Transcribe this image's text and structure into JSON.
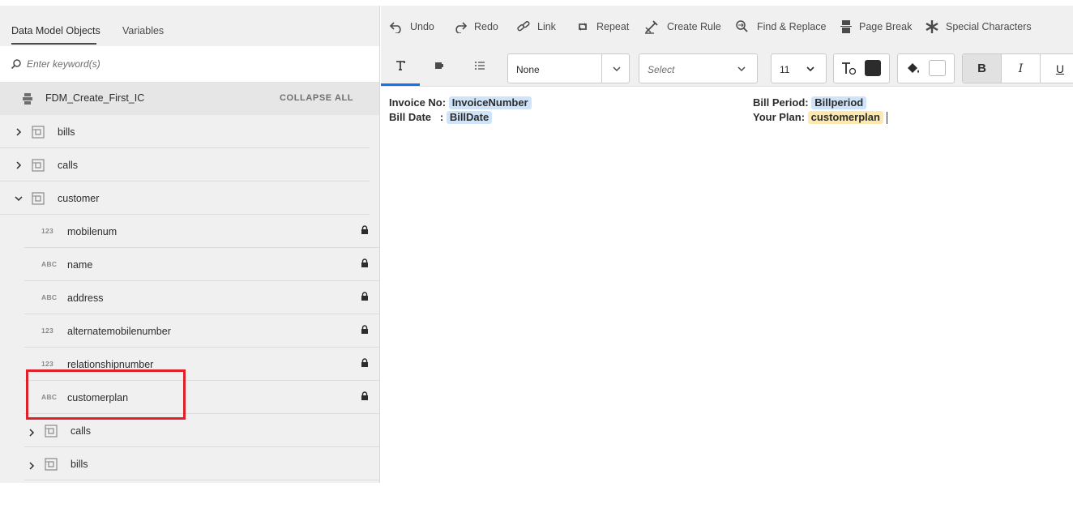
{
  "left_panel": {
    "tabs": [
      {
        "label": "Data Model Objects",
        "active": true
      },
      {
        "label": "Variables",
        "active": false
      }
    ],
    "search": {
      "placeholder": "Enter keyword(s)",
      "value": ""
    },
    "data_model": {
      "title": "FDM_Create_First_IC",
      "collapse_label": "COLLAPSE ALL"
    },
    "tree": [
      {
        "label": "bills",
        "kind": "object",
        "expanded": false,
        "level": 0
      },
      {
        "label": "calls",
        "kind": "object",
        "expanded": false,
        "level": 0
      },
      {
        "label": "customer",
        "kind": "object",
        "expanded": true,
        "level": 0
      },
      {
        "label": "mobilenum",
        "kind": "property",
        "type": "123",
        "level": 1,
        "locked": true
      },
      {
        "label": "name",
        "kind": "property",
        "type": "ABC",
        "level": 1,
        "locked": true
      },
      {
        "label": "address",
        "kind": "property",
        "type": "ABC",
        "level": 1,
        "locked": true
      },
      {
        "label": "alternatemobilenumber",
        "kind": "property",
        "type": "123",
        "level": 1,
        "locked": true
      },
      {
        "label": "relationshipnumber",
        "kind": "property",
        "type": "123",
        "level": 1,
        "locked": true
      },
      {
        "label": "customerplan",
        "kind": "property",
        "type": "ABC",
        "level": 1,
        "locked": true,
        "highlighted": true
      },
      {
        "label": "calls",
        "kind": "object",
        "expanded": false,
        "level": 1
      },
      {
        "label": "bills",
        "kind": "object",
        "expanded": false,
        "level": 1
      }
    ]
  },
  "toolbar": {
    "undo": "Undo",
    "redo": "Redo",
    "link": "Link",
    "repeat": "Repeat",
    "create_rule": "Create Rule",
    "find_replace": "Find & Replace",
    "page_break": "Page Break",
    "special_chars": "Special Characters"
  },
  "format_bar": {
    "style_value": "None",
    "font_placeholder": "Select",
    "size_value": "11",
    "text_color": "#2c2c2c",
    "highlight_color": "#ffffff",
    "bold": "B",
    "italic": "I",
    "underline": "U"
  },
  "editor": {
    "line1_left_label": "Invoice No:",
    "line1_left_field": "InvoiceNumber",
    "line2_left_label": "Bill Date   :",
    "line2_left_field": "BillDate",
    "line1_right_label": "Bill Period:",
    "line1_right_field": "Billperiod",
    "line2_right_label": "Your Plan:",
    "line2_right_field": "customerplan"
  },
  "colors": {
    "accent": "#1473e6",
    "highlight_box": "#e0202a",
    "chip_blue": "#cfe4fb",
    "chip_yellow": "#fde8b0"
  }
}
